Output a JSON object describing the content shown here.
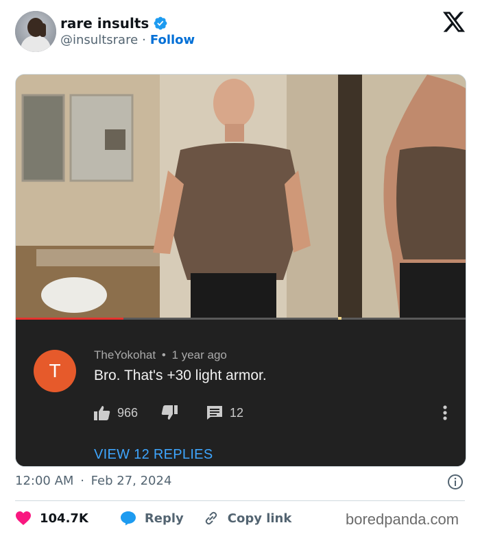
{
  "author": {
    "display_name": "rare insults",
    "handle": "@insultsrare",
    "separator": "·",
    "follow_label": "Follow",
    "verified": true,
    "verified_color": "#1d9bf0"
  },
  "platform_icon": "x-logo-icon",
  "media": {
    "video": {
      "progress": 0.24,
      "progress_color": "#e6322e"
    },
    "comment": {
      "avatar_letter": "T",
      "avatar_color": "#e65a2b",
      "username": "TheYokohat",
      "dot": "•",
      "time_ago": "1 year ago",
      "text": "Bro. That's +30 light armor.",
      "likes": "966",
      "replies_count": "12",
      "view_replies_label": "VIEW 12 REPLIES",
      "link_color": "#3ea6ff"
    }
  },
  "post": {
    "time": "12:00 AM",
    "separator": "·",
    "date": "Feb 27, 2024",
    "likes": "104.7K",
    "reply_label": "Reply",
    "copy_link_label": "Copy link",
    "like_color": "#f91880"
  },
  "watermark": "boredpanda.com"
}
